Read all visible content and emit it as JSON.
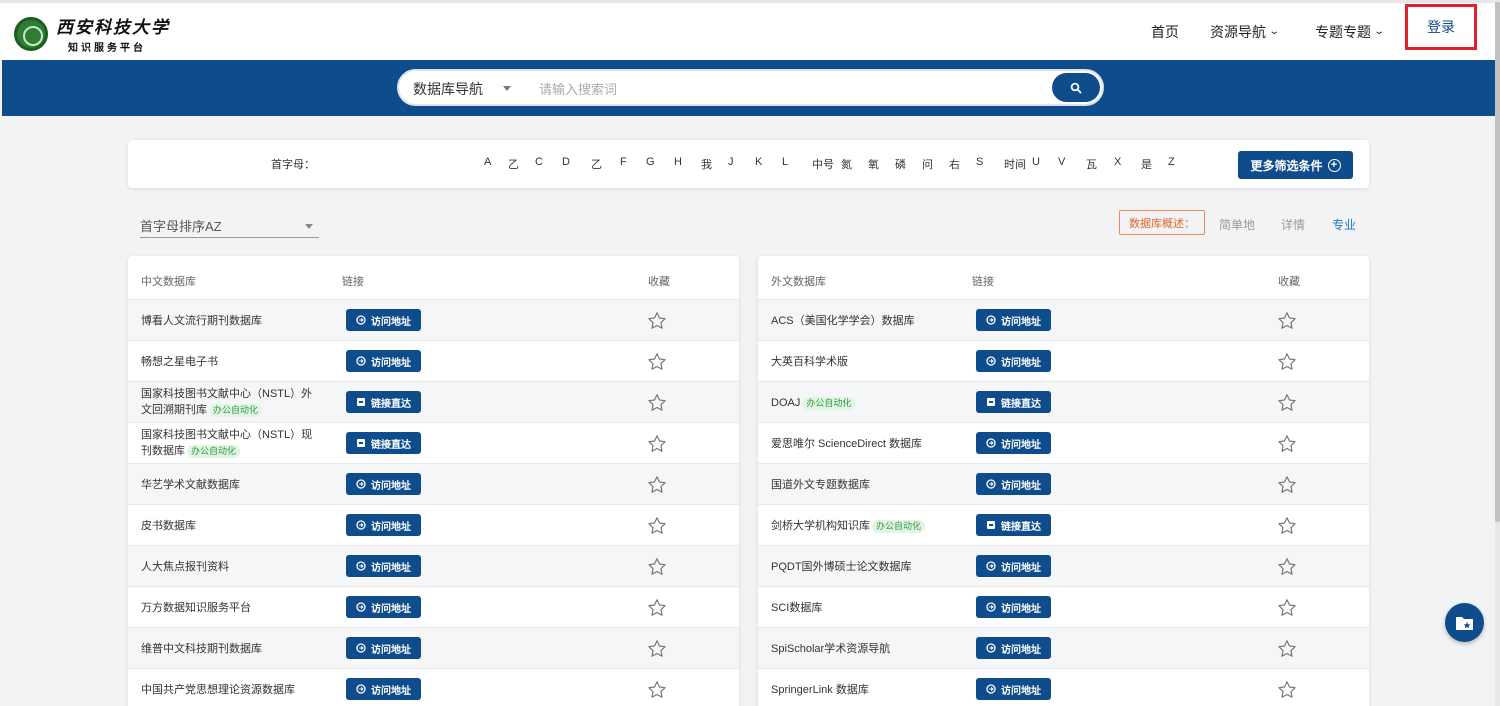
{
  "header": {
    "logo_main": "西安科技大学",
    "logo_sub": "知识服务平台",
    "nav": {
      "home": "首页",
      "resources": "资源导航",
      "topics": "专题专题",
      "login": "登录"
    }
  },
  "search": {
    "select_value": "数据库导航",
    "placeholder": "请输入搜索词"
  },
  "filter": {
    "label": "首字母：",
    "letters": [
      "A",
      "乙",
      "C",
      "D",
      "乙",
      "F",
      "G",
      "H",
      "我",
      "J",
      "K",
      "L",
      "中号",
      "氮",
      "氧",
      "磷",
      "问",
      "右",
      "S",
      "时间",
      "U",
      "V",
      "瓦",
      "X",
      "是",
      "Z"
    ],
    "more_button": "更多筛选条件"
  },
  "sort": {
    "value": "首字母排序AZ"
  },
  "overview": {
    "label": "数据库概述：",
    "options": [
      "简单地",
      "详情",
      "专业"
    ]
  },
  "left_table": {
    "headers": {
      "name": "中文数据库",
      "link": "链接",
      "fav": "收藏"
    },
    "rows": [
      {
        "name": "博看人文流行期刊数据库",
        "tag": "",
        "button": "访问地址",
        "btn_type": "visit"
      },
      {
        "name": "畅想之星电子书",
        "tag": "",
        "button": "访问地址",
        "btn_type": "visit"
      },
      {
        "name": "国家科技图书文献中心（NSTL）外文回溯期刊库",
        "tag": "办公自动化",
        "button": "链接直达",
        "btn_type": "direct"
      },
      {
        "name": "国家科技图书文献中心（NSTL）现刊数据库",
        "tag": "办公自动化",
        "button": "链接直达",
        "btn_type": "direct"
      },
      {
        "name": "华艺学术文献数据库",
        "tag": "",
        "button": "访问地址",
        "btn_type": "visit"
      },
      {
        "name": "皮书数据库",
        "tag": "",
        "button": "访问地址",
        "btn_type": "visit"
      },
      {
        "name": "人大焦点报刊资料",
        "tag": "",
        "button": "访问地址",
        "btn_type": "visit"
      },
      {
        "name": "万方数据知识服务平台",
        "tag": "",
        "button": "访问地址",
        "btn_type": "visit"
      },
      {
        "name": "维普中文科技期刊数据库",
        "tag": "",
        "button": "访问地址",
        "btn_type": "visit"
      },
      {
        "name": "中国共产党思想理论资源数据库",
        "tag": "",
        "button": "访问地址",
        "btn_type": "visit"
      }
    ]
  },
  "right_table": {
    "headers": {
      "name": "外文数据库",
      "link": "链接",
      "fav": "收藏"
    },
    "rows": [
      {
        "name": "ACS（美国化学学会）数据库",
        "tag": "",
        "button": "访问地址",
        "btn_type": "visit"
      },
      {
        "name": "大英百科学术版",
        "tag": "",
        "button": "访问地址",
        "btn_type": "visit"
      },
      {
        "name": "DOAJ",
        "tag": "办公自动化",
        "button": "链接直达",
        "btn_type": "direct"
      },
      {
        "name": "爱思唯尔 ScienceDirect 数据库",
        "tag": "",
        "button": "访问地址",
        "btn_type": "visit"
      },
      {
        "name": "国道外文专题数据库",
        "tag": "",
        "button": "访问地址",
        "btn_type": "visit"
      },
      {
        "name": "剑桥大学机构知识库",
        "tag": "办公自动化",
        "button": "链接直达",
        "btn_type": "direct"
      },
      {
        "name": "PQDT国外博硕士论文数据库",
        "tag": "",
        "button": "访问地址",
        "btn_type": "visit"
      },
      {
        "name": "SCI数据库",
        "tag": "",
        "button": "访问地址",
        "btn_type": "visit"
      },
      {
        "name": "SpiScholar学术资源导航",
        "tag": "",
        "button": "访问地址",
        "btn_type": "visit"
      },
      {
        "name": "SpringerLink 数据库",
        "tag": "",
        "button": "访问地址",
        "btn_type": "visit"
      }
    ]
  },
  "colors": {
    "primary": "#0f4c8c",
    "tag_green": "#2e9a45",
    "overview_orange": "#e7642c",
    "login_border": "#e0202a"
  },
  "icons": {
    "search": "search-icon",
    "star": "star-outline-icon",
    "visit": "link-circle-icon",
    "direct": "square-link-icon",
    "fab": "folder-star-icon"
  }
}
